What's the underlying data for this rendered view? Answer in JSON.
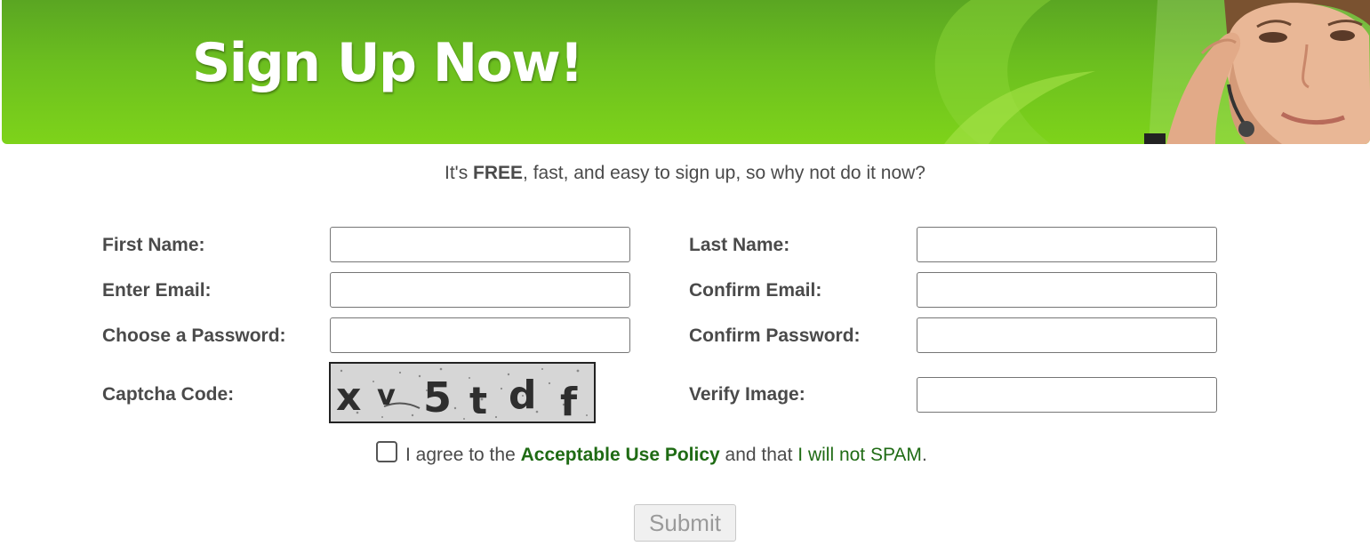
{
  "banner": {
    "title": "Sign Up Now!",
    "background_color": "#6cbf1f",
    "image": "support-woman-with-headset"
  },
  "intro": {
    "prefix": "It's ",
    "emphasis": "FREE",
    "suffix": ", fast, and easy to sign up, so why not do it now?"
  },
  "form": {
    "first_name": {
      "label": "First Name:",
      "value": ""
    },
    "last_name": {
      "label": "Last Name:",
      "value": ""
    },
    "email": {
      "label": "Enter Email:",
      "value": ""
    },
    "confirm_email": {
      "label": "Confirm Email:",
      "value": ""
    },
    "password": {
      "label": "Choose a Password:",
      "value": ""
    },
    "confirm_password": {
      "label": "Confirm Password:",
      "value": ""
    },
    "captcha": {
      "label": "Captcha Code:",
      "code": "xv5tdf"
    },
    "verify": {
      "label": "Verify Image:",
      "value": ""
    }
  },
  "agreement": {
    "checked": false,
    "prefix": "I agree to the ",
    "policy_link": "Acceptable Use Policy",
    "middle": " and that ",
    "spam_link": "I will not SPAM",
    "suffix": "."
  },
  "submit": {
    "label": "Submit",
    "disabled": true
  },
  "colors": {
    "link_green": "#1f6b14",
    "text_gray": "#4a4a4a"
  }
}
